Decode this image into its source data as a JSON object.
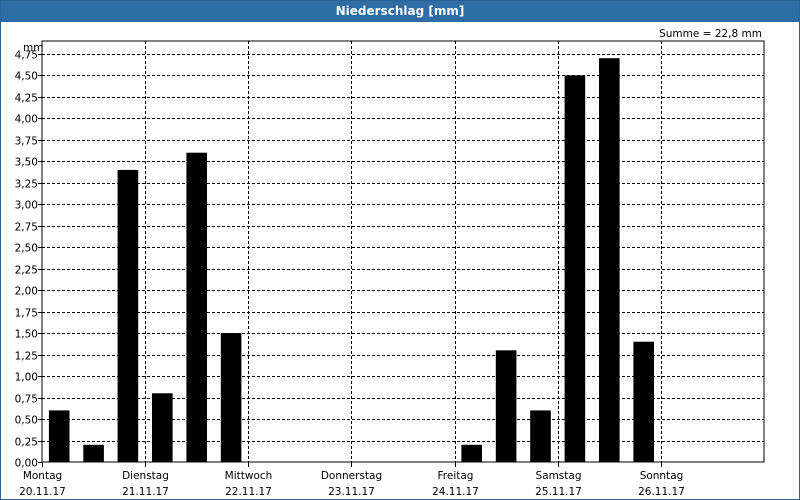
{
  "window": {
    "title": "Niederschlag [mm]"
  },
  "summary": {
    "text": "Summe = 22,8 mm"
  },
  "chart_data": {
    "type": "bar",
    "title": "Niederschlag [mm]",
    "ylabel": "mm",
    "xlabel": "",
    "ylim": [
      0,
      4.9
    ],
    "grid": true,
    "yticks": [
      "0,00",
      "0,25",
      "0,50",
      "0,75",
      "1,00",
      "1,25",
      "1,50",
      "1,75",
      "2,00",
      "2,25",
      "2,50",
      "2,75",
      "3,00",
      "3,25",
      "3,50",
      "3,75",
      "4,00",
      "4,25",
      "4,50",
      "4,75"
    ],
    "days": [
      {
        "name": "Montag",
        "date": "20.11.17"
      },
      {
        "name": "Dienstag",
        "date": "21.11.17"
      },
      {
        "name": "Mittwoch",
        "date": "22.11.17"
      },
      {
        "name": "Donnerstag",
        "date": "23.11.17"
      },
      {
        "name": "Freitag",
        "date": "24.11.17"
      },
      {
        "name": "Samstag",
        "date": "25.11.17"
      },
      {
        "name": "Sonntag",
        "date": "26.11.17"
      }
    ],
    "bars_per_day": 3,
    "values": [
      0.6,
      0.2,
      3.4,
      0.8,
      3.6,
      1.5,
      0,
      0,
      0,
      0,
      0,
      0,
      0.2,
      1.3,
      0.6,
      4.5,
      4.7,
      1.4,
      0,
      0,
      0
    ],
    "bar_color": "#000000",
    "grid_color": "#000000"
  }
}
